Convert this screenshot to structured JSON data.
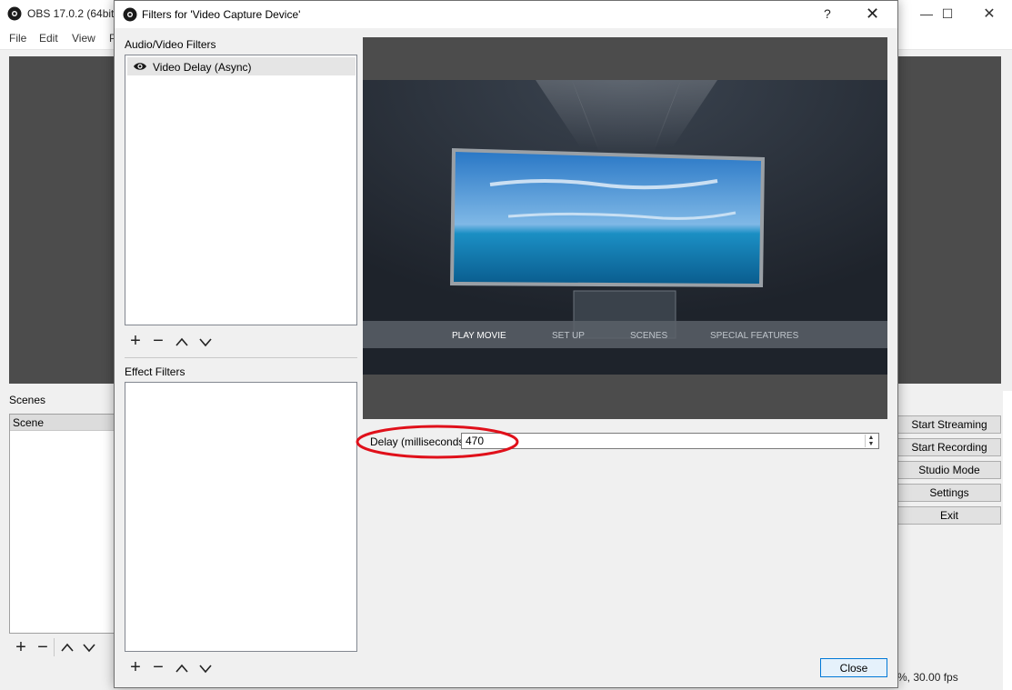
{
  "main_window": {
    "title": "OBS 17.0.2 (64bit,",
    "menu": [
      "File",
      "Edit",
      "View",
      "P"
    ],
    "scenes_label": "Scenes",
    "scenes_column_header": "Scene",
    "buttons": [
      "Start Streaming",
      "Start Recording",
      "Studio Mode",
      "Settings",
      "Exit"
    ],
    "status_fps": "%, 30.00 fps"
  },
  "dialog": {
    "title": "Filters for 'Video Capture Device'",
    "help": "?",
    "close_x": "✕",
    "av_filters_label": "Audio/Video Filters",
    "av_filters": [
      {
        "label": "Video Delay (Async)",
        "icon": "eye-icon",
        "selected": true
      }
    ],
    "effect_filters_label": "Effect Filters",
    "effect_filters": [],
    "delay": {
      "label": "Delay (milliseconds)",
      "value": "470"
    },
    "close_button": "Close"
  },
  "preview_menu": [
    "PLAY MOVIE",
    "SET UP",
    "SCENES",
    "SPECIAL FEATURES"
  ],
  "colors": {
    "highlight": "#e0101a",
    "selection": "#0078d7",
    "preview_bg": "#4c4c4c"
  }
}
